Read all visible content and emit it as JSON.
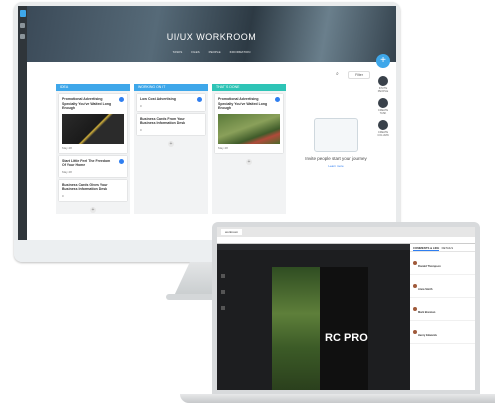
{
  "workspace": {
    "title": "UI/UX WORKROOM",
    "tabs": [
      "TASKS",
      "FILES",
      "PEOPLE",
      "INFORMATION"
    ],
    "filter_label": "Filter"
  },
  "columns": [
    {
      "name": "IDEA",
      "color": "#3ea7ea",
      "cards": [
        {
          "title": "Promotional Advertising Specialty You've Waited Long Enough",
          "meta": "May 28",
          "image": true
        },
        {
          "title": "Start Little Feel The Freedom Of Your Home",
          "meta": "May 28",
          "image": false
        },
        {
          "title": "Business Cards Gives Your Business Information Desk",
          "meta": "0",
          "image": false
        }
      ]
    },
    {
      "name": "WORKING ON IT",
      "color": "#3ea7ea",
      "cards": [
        {
          "title": "Low Cost Advertising",
          "meta": "0",
          "image": false
        },
        {
          "title": "Business Cards From Your Business Information Desk",
          "meta": "0",
          "image": false
        }
      ]
    },
    {
      "name": "THAT`S DONE",
      "color": "#2ec4b6",
      "cards": [
        {
          "title": "Promotional Advertising Specialty You've Waited Long Enough",
          "meta": "May 28",
          "image": true
        }
      ]
    }
  ],
  "empty_state": {
    "heading": "Invite people start your journey",
    "link": "Learn more"
  },
  "actions": [
    "INVITE PEOPLE",
    "CREATE TASK",
    "CREATE COLUMN"
  ],
  "laptop": {
    "tab": "workroom",
    "comments_tab": "COMMENTS & LIKE",
    "details_tab": "DETAILS",
    "magazine_title": "RC PRO",
    "comments": [
      {
        "name": "Ronald Thompson",
        "text": "Text"
      },
      {
        "name": "Anna Smith",
        "text": "Text"
      },
      {
        "name": "Mark Brennan",
        "text": "Text"
      },
      {
        "name": "Henry Edwards",
        "text": "Text"
      }
    ]
  }
}
